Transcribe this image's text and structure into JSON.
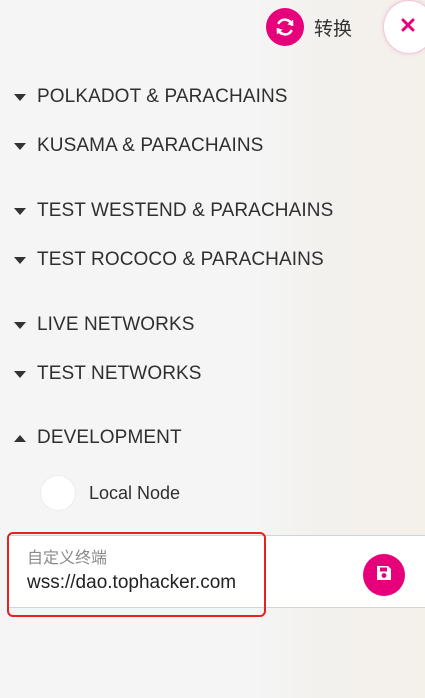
{
  "header": {
    "switch_label": "转换",
    "switch_icon": "sync-icon",
    "close_icon": "close-icon"
  },
  "groups": [
    {
      "label": "POLKADOT & PARACHAINS",
      "expanded": false
    },
    {
      "label": "KUSAMA & PARACHAINS",
      "expanded": false
    },
    {
      "label": "TEST WESTEND & PARACHAINS",
      "expanded": false
    },
    {
      "label": "TEST ROCOCO & PARACHAINS",
      "expanded": false
    },
    {
      "label": "LIVE NETWORKS",
      "expanded": false
    },
    {
      "label": "TEST NETWORKS",
      "expanded": false
    },
    {
      "label": "DEVELOPMENT",
      "expanded": true
    }
  ],
  "development": {
    "nodes": [
      {
        "label": "Local Node",
        "selected": false
      }
    ]
  },
  "custom_endpoint": {
    "label": "自定义终端",
    "value": "wss://dao.tophacker.com",
    "save_icon": "save-icon"
  },
  "colors": {
    "accent": "#e6007a",
    "highlight": "#e82020"
  }
}
